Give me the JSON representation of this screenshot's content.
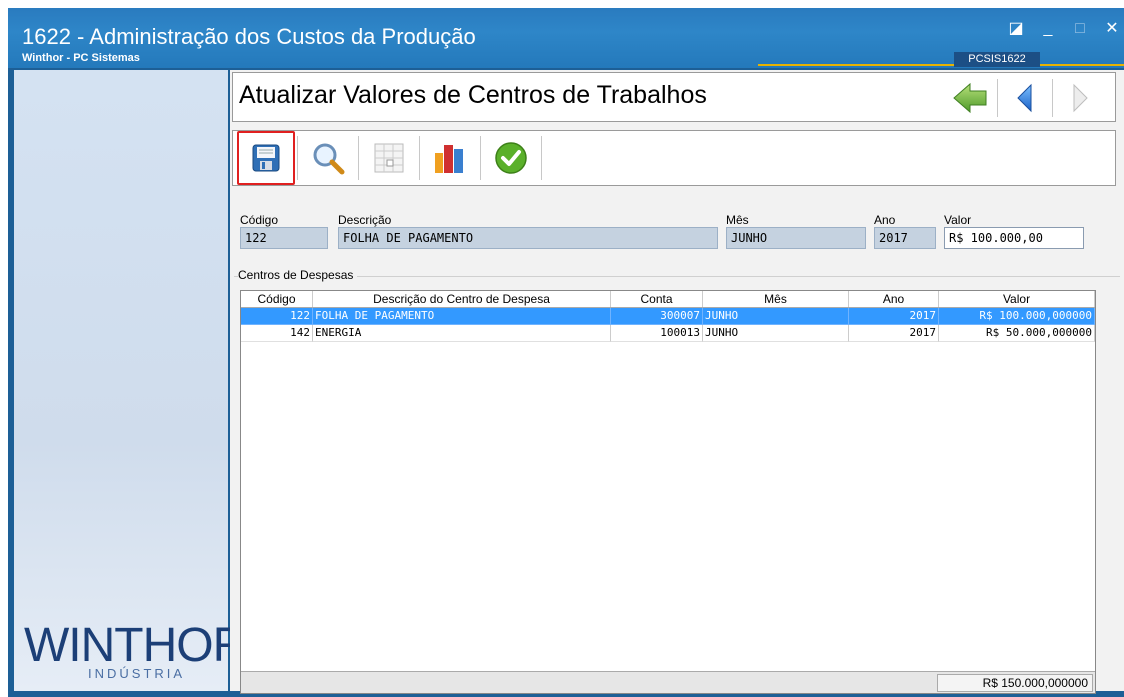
{
  "window": {
    "title": "1622 - Administração dos Custos da Produção",
    "subtitle": "Winthor - PC Sistemas",
    "code": "PCSIS1622",
    "buttons": [
      "◪",
      "_",
      "□",
      "✕"
    ]
  },
  "logo": {
    "main": "WINTHOR",
    "sub": "INDÚSTRIA"
  },
  "page": {
    "title": "Atualizar Valores de Centros de Trabalhos",
    "nav": [
      "back-arrow-icon",
      "previous-icon",
      "next-icon"
    ]
  },
  "toolbar": {
    "items": [
      "save-icon",
      "search-icon",
      "calculator-icon",
      "chart-icon",
      "confirm-icon"
    ],
    "selected": "save-icon"
  },
  "form": {
    "codigo_label": "Código",
    "codigo_value": "122",
    "descricao_label": "Descrição",
    "descricao_value": "FOLHA DE PAGAMENTO",
    "mes_label": "Mês",
    "mes_value": "JUNHO",
    "ano_label": "Ano",
    "ano_value": "2017",
    "valor_label": "Valor",
    "valor_value": "R$ 100.000,00"
  },
  "grid": {
    "group_title": "Centros de Despesas",
    "headers": [
      "Código",
      "Descrição do Centro de Despesa",
      "Conta",
      "Mês",
      "Ano",
      "Valor"
    ],
    "rows": [
      {
        "codigo": "122",
        "descricao": "FOLHA DE PAGAMENTO",
        "conta": "300007",
        "mes": "JUNHO",
        "ano": "2017",
        "valor": "R$ 100.000,000000"
      },
      {
        "codigo": "142",
        "descricao": "ENERGIA",
        "conta": "100013",
        "mes": "JUNHO",
        "ano": "2017",
        "valor": "R$ 50.000,000000"
      }
    ],
    "total": "R$ 150.000,000000"
  },
  "colors": {
    "titlebar": "#2a7bbf",
    "selection": "#3399ff",
    "highlight_border": "#e02020"
  }
}
